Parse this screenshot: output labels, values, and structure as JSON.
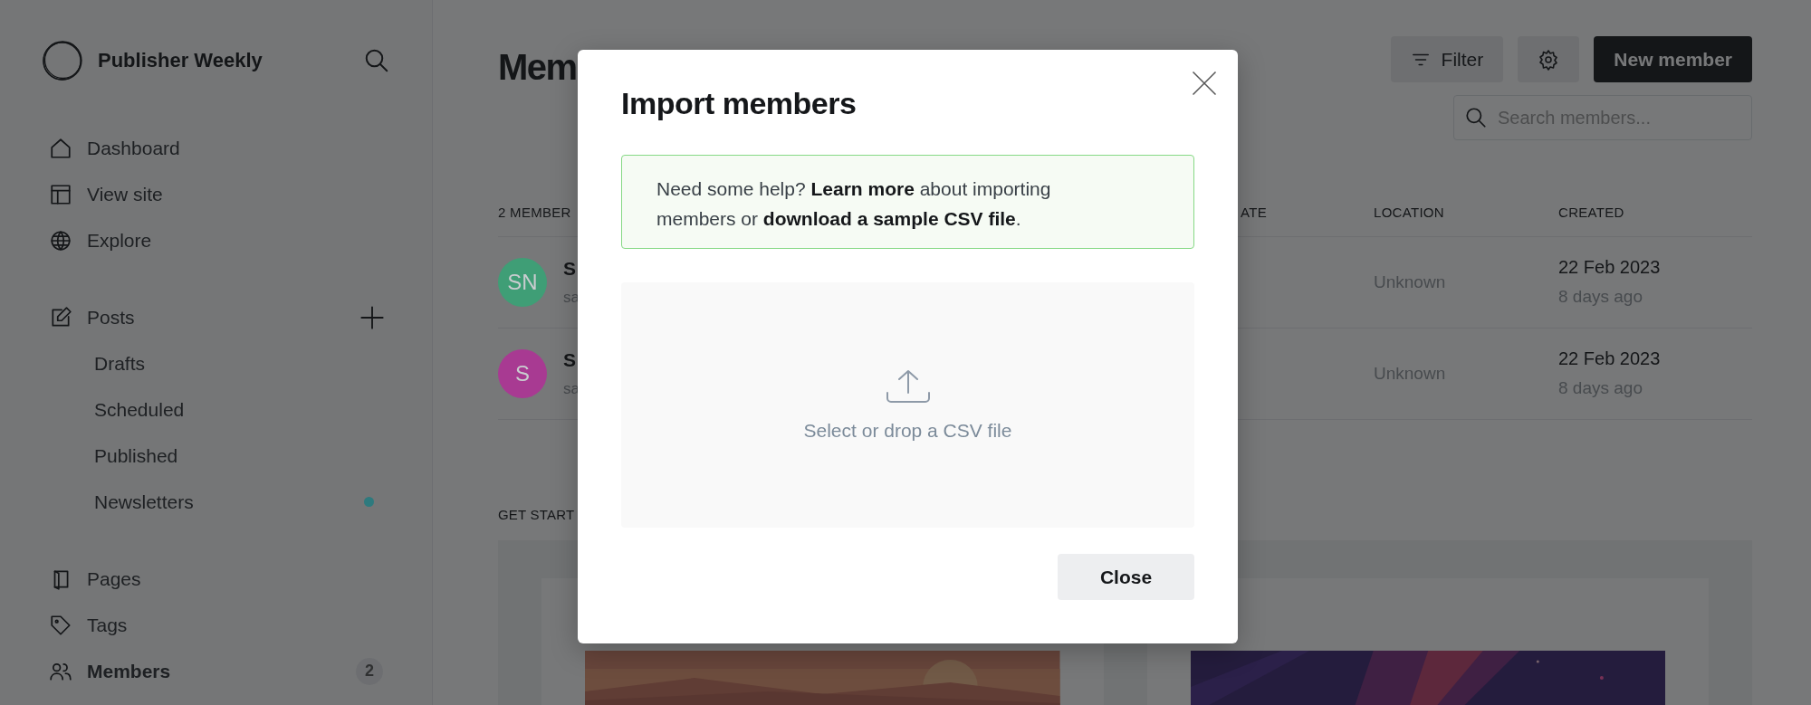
{
  "sidebar": {
    "site_title": "Publisher Weekly",
    "nav_groups": [
      [
        {
          "label": "Dashboard",
          "kind": "main",
          "selected": false
        },
        {
          "label": "View site",
          "kind": "main",
          "selected": false
        },
        {
          "label": "Explore",
          "kind": "main",
          "selected": false
        }
      ],
      [
        {
          "label": "Posts",
          "kind": "main",
          "selected": false,
          "add": true
        },
        {
          "label": "Drafts",
          "kind": "sub",
          "selected": false
        },
        {
          "label": "Scheduled",
          "kind": "sub",
          "selected": false
        },
        {
          "label": "Published",
          "kind": "sub",
          "selected": false
        },
        {
          "label": "Newsletters",
          "kind": "sub",
          "selected": false,
          "color": "#2e7a7e"
        }
      ],
      [
        {
          "label": "Pages",
          "kind": "main",
          "selected": false
        },
        {
          "label": "Tags",
          "kind": "main",
          "selected": false
        },
        {
          "label": "Members",
          "kind": "main",
          "selected": true,
          "count": "2"
        }
      ]
    ]
  },
  "header": {
    "title": "Mem",
    "filter_button": "Filter",
    "new_button": "New member",
    "search": {
      "placeholder": "Search members..."
    }
  },
  "table": {
    "columns": [
      "2 MEMBER",
      "ATE",
      "LOCATION",
      "CREATED"
    ],
    "rows": [
      {
        "initials": "SN",
        "color": "#3f9e76",
        "name": "S",
        "email": "sa",
        "location": "Unknown",
        "created": "22 Feb 2023",
        "ago": "8 days ago"
      },
      {
        "initials": "S",
        "color": "#a83a92",
        "name": "S",
        "email": "sa",
        "location": "Unknown",
        "created": "22 Feb 2023",
        "ago": "8 days ago"
      }
    ]
  },
  "get_started": {
    "heading": "GET START"
  },
  "modal": {
    "title": "Import members",
    "help": [
      {
        "kind": "text",
        "text": "Need some help? "
      },
      {
        "kind": "link",
        "text": "Learn more"
      },
      {
        "kind": "text",
        "text": " about importing members or "
      },
      {
        "kind": "link",
        "text": "download a sample CSV file"
      },
      {
        "kind": "text",
        "text": "."
      }
    ],
    "drop_text": "Select or drop a CSV file",
    "close_button": "Close"
  }
}
